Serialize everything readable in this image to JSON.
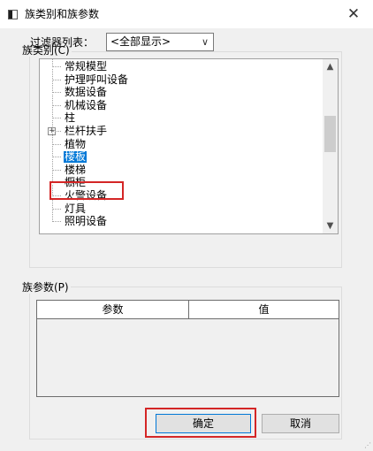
{
  "window": {
    "title": "族类别和族参数",
    "close_glyph": "✕"
  },
  "category_group": {
    "label": "族类别(C)",
    "filter_label": "过滤器列表：",
    "filter_value": "<全部显示>",
    "tree_items": [
      {
        "label": "常规模型",
        "expandable": false,
        "selected": false
      },
      {
        "label": "护理呼叫设备",
        "expandable": false,
        "selected": false
      },
      {
        "label": "数据设备",
        "expandable": false,
        "selected": false
      },
      {
        "label": "机械设备",
        "expandable": false,
        "selected": false
      },
      {
        "label": "柱",
        "expandable": false,
        "selected": false
      },
      {
        "label": "栏杆扶手",
        "expandable": true,
        "selected": false
      },
      {
        "label": "植物",
        "expandable": false,
        "selected": false
      },
      {
        "label": "楼板",
        "expandable": false,
        "selected": true
      },
      {
        "label": "楼梯",
        "expandable": false,
        "selected": false
      },
      {
        "label": "橱柜",
        "expandable": false,
        "selected": false
      },
      {
        "label": "火警设备",
        "expandable": false,
        "selected": false
      },
      {
        "label": "灯具",
        "expandable": false,
        "selected": false
      },
      {
        "label": "照明设备",
        "expandable": false,
        "selected": false
      }
    ]
  },
  "params_group": {
    "label": "族参数(P)",
    "columns": [
      "参数",
      "值"
    ]
  },
  "buttons": {
    "ok": "确定",
    "cancel": "取消"
  },
  "colors": {
    "selection": "#0078d7",
    "annotation_red": "#d42626"
  }
}
